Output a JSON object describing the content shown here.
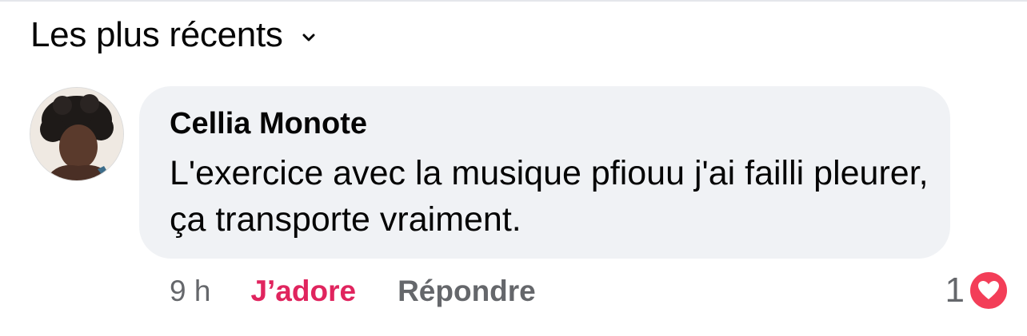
{
  "sort": {
    "label": "Les plus récents"
  },
  "comment": {
    "author": "Cellia Monote",
    "text": "L'exercice avec la musique pfiouu j'ai failli pleurer, ça transporte vraiment.",
    "time": "9 h",
    "love_label": "J’adore",
    "reply_label": "Répondre",
    "reaction_count": "1",
    "reaction_icon": "heart-icon"
  },
  "colors": {
    "love_accent": "#e0245e",
    "heart_badge": "#f33e58",
    "bubble_bg": "#f0f2f5",
    "secondary_text": "#65676b"
  }
}
